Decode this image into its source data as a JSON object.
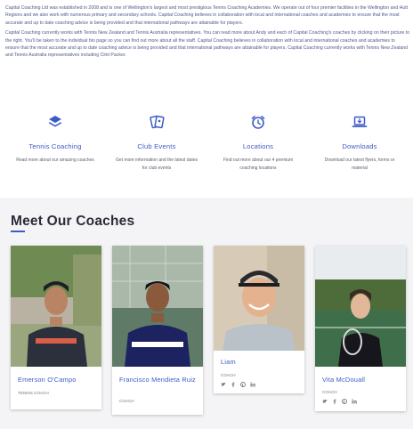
{
  "intro": {
    "para1": "Capital Coaching Ltd was established in 2008 and is one of Wellington's largest and most prestigious Tennis Coaching Academies. We operate out of four premier facilities in the Wellington and Hutt Regions and we also work with numerous primary and secondary schools. Capital Coaching believes in collaboration with local and international coaches and academies to ensure that the most accurate and up to date coaching advice is being provided and that international pathways are attainable for players.",
    "para2": "Capital Coaching currently works with Tennis New Zealand and Tennis Australia representatives. You can read more about Andy and each of Capital Coaching's coaches by clicking on their picture to the right. You'll be taken to the individual bio page so you can find out more about all the staff. Capital Coaching believes in collaboration with local and international coaches and academies to ensure that the most accurate and up to date coaching advice is being provided and that international pathways are attainable for players. Capital Coaching currently works with Tennis New Zealand and Tennis Australia representatives including Clint Packer."
  },
  "features": [
    {
      "icon": "layers-icon",
      "title": "Tennis Coaching",
      "desc": "Read more about our amazing coaches"
    },
    {
      "icon": "cards-icon",
      "title": "Club Events",
      "desc": "Get more information and the latest dates for club events"
    },
    {
      "icon": "alarm-clock-icon",
      "title": "Locations",
      "desc": "Find out more about our 4 premium coaching locations"
    },
    {
      "icon": "laptop-download-icon",
      "title": "Downloads",
      "desc": "Download our latest flyers, forms or material"
    }
  ],
  "coaches_section": {
    "heading": "Meet Our Coaches",
    "coaches": [
      {
        "name": "Emerson O'Campo",
        "role": "TENNIS COACH"
      },
      {
        "name": "Francisco Mendieta Ruiz",
        "role": "COACH"
      },
      {
        "name": "Liam",
        "role": "COACH"
      },
      {
        "name": "Vita McDouall",
        "role": "COACH"
      }
    ]
  },
  "colors": {
    "accent": "#3d5bc7",
    "heading": "#2b2b3a",
    "section_bg": "#f4f4f6",
    "body_text": "#4f5a8a"
  }
}
